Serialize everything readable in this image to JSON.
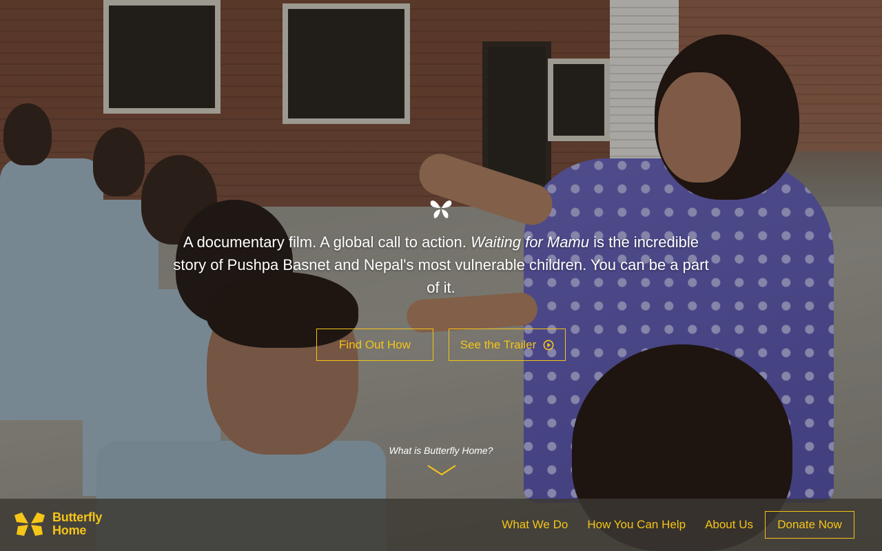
{
  "hero": {
    "text_before": "A documentary film. A global call to action. ",
    "film_title": "Waiting for Mamu",
    "text_after": " is the incredible story of Pushpa Basnet and Nepal's most vulnerable children. You can be a part of it.",
    "cta_primary": "Find Out How",
    "cta_secondary": "See the Trailer",
    "what_is_link": "What is Butterfly Home?"
  },
  "brand": {
    "line1": "Butterfly",
    "line2": "Home"
  },
  "nav": {
    "items": [
      "What We Do",
      "How You Can Help",
      "About Us"
    ],
    "donate_label": "Donate Now"
  },
  "colors": {
    "accent": "#f5c518",
    "text_light": "#ffffff",
    "navbar_bg": "#3c3832"
  },
  "icons": {
    "hero_mark": "butterfly-icon",
    "trailer": "play-circle-icon",
    "scroll": "chevron-down-icon",
    "brand": "butterfly-logo-icon"
  }
}
